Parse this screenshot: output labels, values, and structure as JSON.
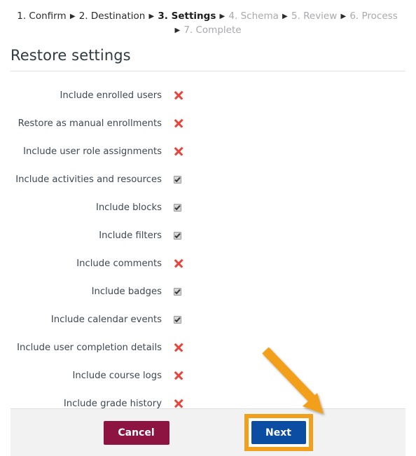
{
  "breadcrumb": {
    "separator": "▶",
    "steps": [
      {
        "label": "1. Confirm",
        "state": "done"
      },
      {
        "label": "2. Destination",
        "state": "done"
      },
      {
        "label": "3. Settings",
        "state": "current"
      },
      {
        "label": "4. Schema",
        "state": "todo"
      },
      {
        "label": "5. Review",
        "state": "todo"
      },
      {
        "label": "6. Process",
        "state": "todo"
      },
      {
        "label": "7. Complete",
        "state": "todo"
      }
    ]
  },
  "page": {
    "title": "Restore settings"
  },
  "settings": [
    {
      "label": "Include enrolled users",
      "indicator": "x-mark"
    },
    {
      "label": "Restore as manual enrollments",
      "indicator": "x-mark"
    },
    {
      "label": "Include user role assignments",
      "indicator": "x-mark"
    },
    {
      "label": "Include activities and resources",
      "indicator": "checkbox-checked"
    },
    {
      "label": "Include blocks",
      "indicator": "checkbox-checked"
    },
    {
      "label": "Include filters",
      "indicator": "checkbox-checked"
    },
    {
      "label": "Include comments",
      "indicator": "x-mark"
    },
    {
      "label": "Include badges",
      "indicator": "checkbox-checked"
    },
    {
      "label": "Include calendar events",
      "indicator": "checkbox-checked"
    },
    {
      "label": "Include user completion details",
      "indicator": "x-mark"
    },
    {
      "label": "Include course logs",
      "indicator": "x-mark"
    },
    {
      "label": "Include grade history",
      "indicator": "x-mark"
    }
  ],
  "footer": {
    "cancel_label": "Cancel",
    "next_label": "Next"
  },
  "annotation": {
    "arrow": "orange-arrow-pointing-to-next-button"
  },
  "colors": {
    "cancel_button": "#8d1340",
    "next_button": "#0b4da2",
    "highlight": "#f2a01c",
    "x_mark": "#e8453c",
    "footer_background": "#f2f2f2",
    "title_text": "#2f3a40"
  }
}
